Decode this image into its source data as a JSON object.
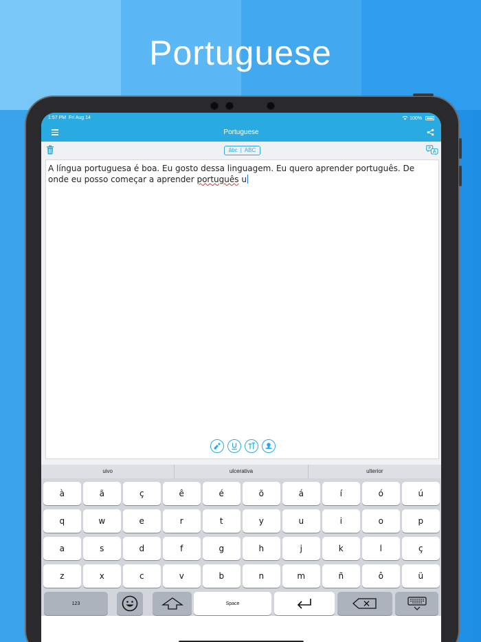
{
  "promo": {
    "title": "Portuguese"
  },
  "colors": {
    "accent": "#29abe2",
    "background": "#2196e6",
    "keyboard": "#d2d5db"
  },
  "status_bar": {
    "time": "1:57 PM",
    "date": "Fri Aug 14",
    "battery": "100%"
  },
  "navbar": {
    "title": "Portuguese",
    "menu_icon": "hamburger-icon",
    "share_icon": "share-icon"
  },
  "toolbar": {
    "case_lower": "âbc",
    "case_sep": "|",
    "case_upper": "ABC",
    "left_icon": "trash-icon",
    "right_icon": "translate-icon"
  },
  "editor": {
    "text_before": "A língua portuguesa é boa. Eu gosto dessa linguagem. Eu quero aprender português. De onde eu posso começar a aprender ",
    "misspelled_word": "português",
    "text_after": " u",
    "format_buttons": [
      "clear-format-icon",
      "underline-icon",
      "text-size-icon",
      "stamp-icon"
    ]
  },
  "keyboard": {
    "suggestions": [
      "uivo",
      "ulcerativa",
      "ulterior"
    ],
    "rows": [
      [
        "à",
        "ã",
        "ç",
        "ê",
        "é",
        "õ",
        "á",
        "í",
        "ó",
        "ú"
      ],
      [
        "q",
        "w",
        "e",
        "r",
        "t",
        "y",
        "u",
        "i",
        "o",
        "p"
      ],
      [
        "a",
        "s",
        "d",
        "f",
        "g",
        "h",
        "j",
        "k",
        "l",
        "ç"
      ],
      [
        "z",
        "x",
        "c",
        "v",
        "b",
        "n",
        "m",
        "ñ",
        "ô",
        "ü"
      ]
    ],
    "numbers_key": "123",
    "space_key": "Space"
  }
}
